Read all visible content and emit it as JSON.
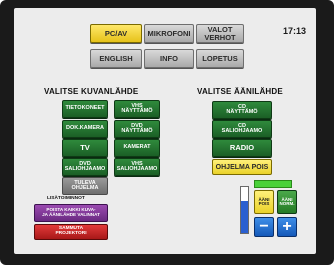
{
  "header": {
    "clock": "17:13",
    "buttons": [
      "PC/AV",
      "MIKROFONI",
      "VALOT\nVERHOT",
      "ENGLISH",
      "INFO",
      "LOPETUS"
    ],
    "active_index": 0
  },
  "video": {
    "title": "VALITSE KUVANLÄHDE",
    "left": [
      "TIETOKONEET",
      "DOK.KAMERA",
      "TV",
      "DVD\nSALIOHJAAMO",
      "TULEVA\nOHJELMA"
    ],
    "right": [
      "VHS\nNÄYTTÄMÖ",
      "DVD\nNÄYTTÄMÖ",
      "KAMERAT",
      "VHS\nSALIOHJAAMO"
    ]
  },
  "audio": {
    "title": "VALITSE ÄÄNILÄHDE",
    "items": [
      "CD\nNÄYTTÄMÖ",
      "CD\nSALIOHJAAMO",
      "RADIO",
      "OHJELMA POIS"
    ]
  },
  "extra": {
    "title": "LISÄTOIMINNOT",
    "clear_button": "POISTA KAIKKI KUVA-\nJA ÄÄNILÄHDE VALINNAT",
    "projector_button": "SAMMUTA\nPROJEKTORI"
  },
  "volume": {
    "level": 0.7,
    "mute_on": "ÄÄNI\nPOIS",
    "mute_off": "ÄÄNI\nNORM.",
    "minus": "−",
    "plus": "+"
  },
  "colors": {
    "active": "#f0d030",
    "source": "#217a30",
    "disabled": "#888888"
  }
}
